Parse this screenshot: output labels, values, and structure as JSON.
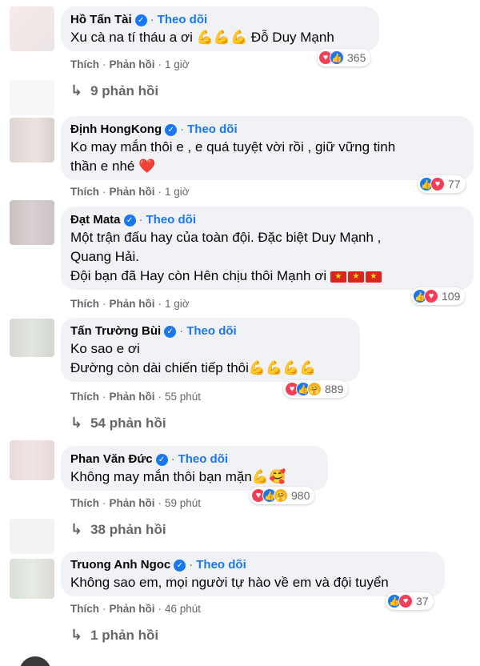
{
  "labels": {
    "follow": "Theo dõi",
    "like": "Thích",
    "reply": "Phản hồi",
    "sep": "·",
    "verified": "✓"
  },
  "comments": [
    {
      "name": "Hồ Tấn Tài",
      "text": "Xu cà na tí tháu a ơi 💪💪💪 Đỗ Duy Mạnh",
      "time": "1 giờ",
      "reactions": "365",
      "replies": "9 phản hồi"
    },
    {
      "name": "Định HongKong",
      "text": "Ko may mắn thôi e , e quá tuyệt vời rồi , giữ vững tinh\nthần e nhé ❤️",
      "time": "1 giờ",
      "reactions": "77"
    },
    {
      "name": "Đạt Mata",
      "text": "Một trận đấu hay của toàn đội. Đặc biệt Duy Mạnh ,\nQuang Hải.\nĐội bạn đã Hay còn Hên chịu thôi Mạnh ơi",
      "time": "1 giờ",
      "reactions": "109"
    },
    {
      "name": "Tấn Trường Bùi",
      "text": "Ko sao e ơi\nĐường còn dài chiến tiếp thôi💪💪💪💪",
      "time": "55 phút",
      "reactions": "889",
      "replies": "54 phản hồi"
    },
    {
      "name": "Phan Văn Đức",
      "text": "Không may mắn thôi bạn mặn💪🥰",
      "time": "59 phút",
      "reactions": "980",
      "replies": "38 phản hồi"
    },
    {
      "name": "Truong Anh Ngoc",
      "text": "Không sao em, mọi người tự hào về em và đội tuyển",
      "time": "46 phút",
      "reactions": "37",
      "replies": "1 phản hồi"
    }
  ],
  "colors": {
    "bubble": "#f0f2f5",
    "accent": "#1877f2",
    "secondary": "#65676b",
    "love": "#f33e58"
  }
}
